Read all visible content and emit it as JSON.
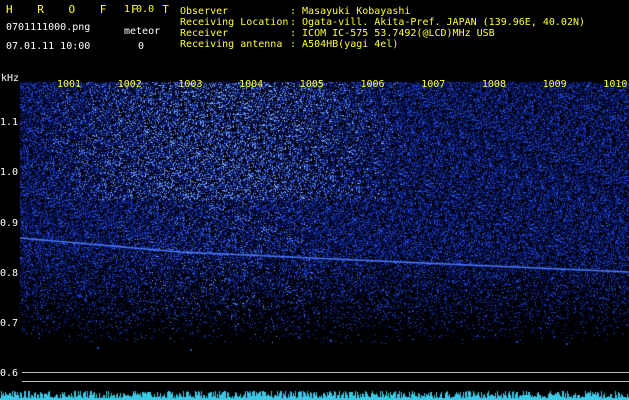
{
  "header": {
    "app_name": "H R O F F T",
    "version": "1.0.0",
    "filename": "0701111000.png",
    "meteor_label": "meteor",
    "datetime": "07.01.11 10:00",
    "meteor_count": "0",
    "info_labels": [
      "Observer",
      "Receiving Location",
      "Receiver",
      "Receiving antenna"
    ],
    "info_values": [
      ": Masayuki Kobayashi",
      ": Ogata-vill. Akita-Pref. JAPAN (139.96E, 40.02N)",
      ": ICOM IC-575 53.7492(@LCD)MHz USB",
      ": A504HB(yagi 4el)"
    ]
  },
  "spectrogram": {
    "y_unit": "kHz",
    "y_ticks": [
      "1.1",
      "1.0",
      "0.9",
      "0.8",
      "0.7",
      "0.6"
    ],
    "x_ticks": [
      "1001",
      "1002",
      "1003",
      "1004",
      "1005",
      "1006",
      "1007",
      "1008",
      "1009",
      "1010"
    ],
    "colors": {
      "background": "#000000",
      "noise": "#1020b0",
      "signal": "#4a78ff",
      "label": "#ffff33"
    }
  }
}
